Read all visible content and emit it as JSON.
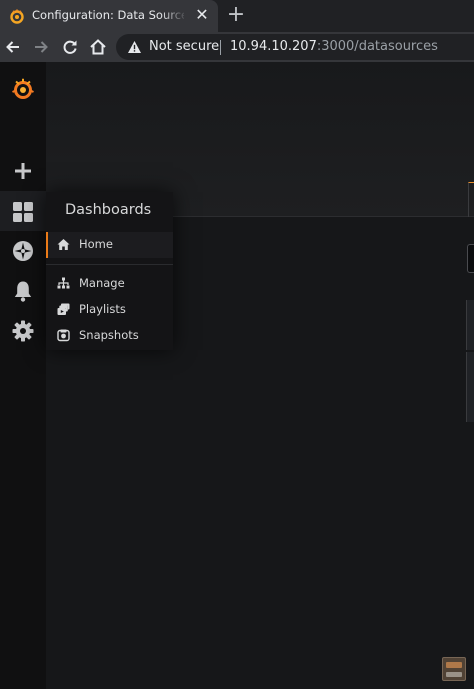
{
  "browser": {
    "tab_title": "Configuration: Data Sources - Grafana",
    "omnibox": {
      "security": "Not secure",
      "url_host": "10.94.10.207",
      "url_path": ":3000/datasources"
    }
  },
  "sidebar": {
    "icons": [
      "grafana-logo-icon",
      "plus-icon",
      "dashboards-grid-icon",
      "explore-compass-icon",
      "alerting-bell-icon",
      "configuration-gear-icon"
    ]
  },
  "dashboards_menu": {
    "title": "Dashboards",
    "items": [
      {
        "label": "Home",
        "icon": "home-icon"
      },
      {
        "label": "Manage",
        "icon": "sitemap-icon"
      },
      {
        "label": "Playlists",
        "icon": "playlist-icon"
      },
      {
        "label": "Snapshots",
        "icon": "camera-icon"
      }
    ]
  },
  "colors": {
    "accent": "#eb7b18",
    "background": "#161719",
    "sidebar": "#101011"
  }
}
